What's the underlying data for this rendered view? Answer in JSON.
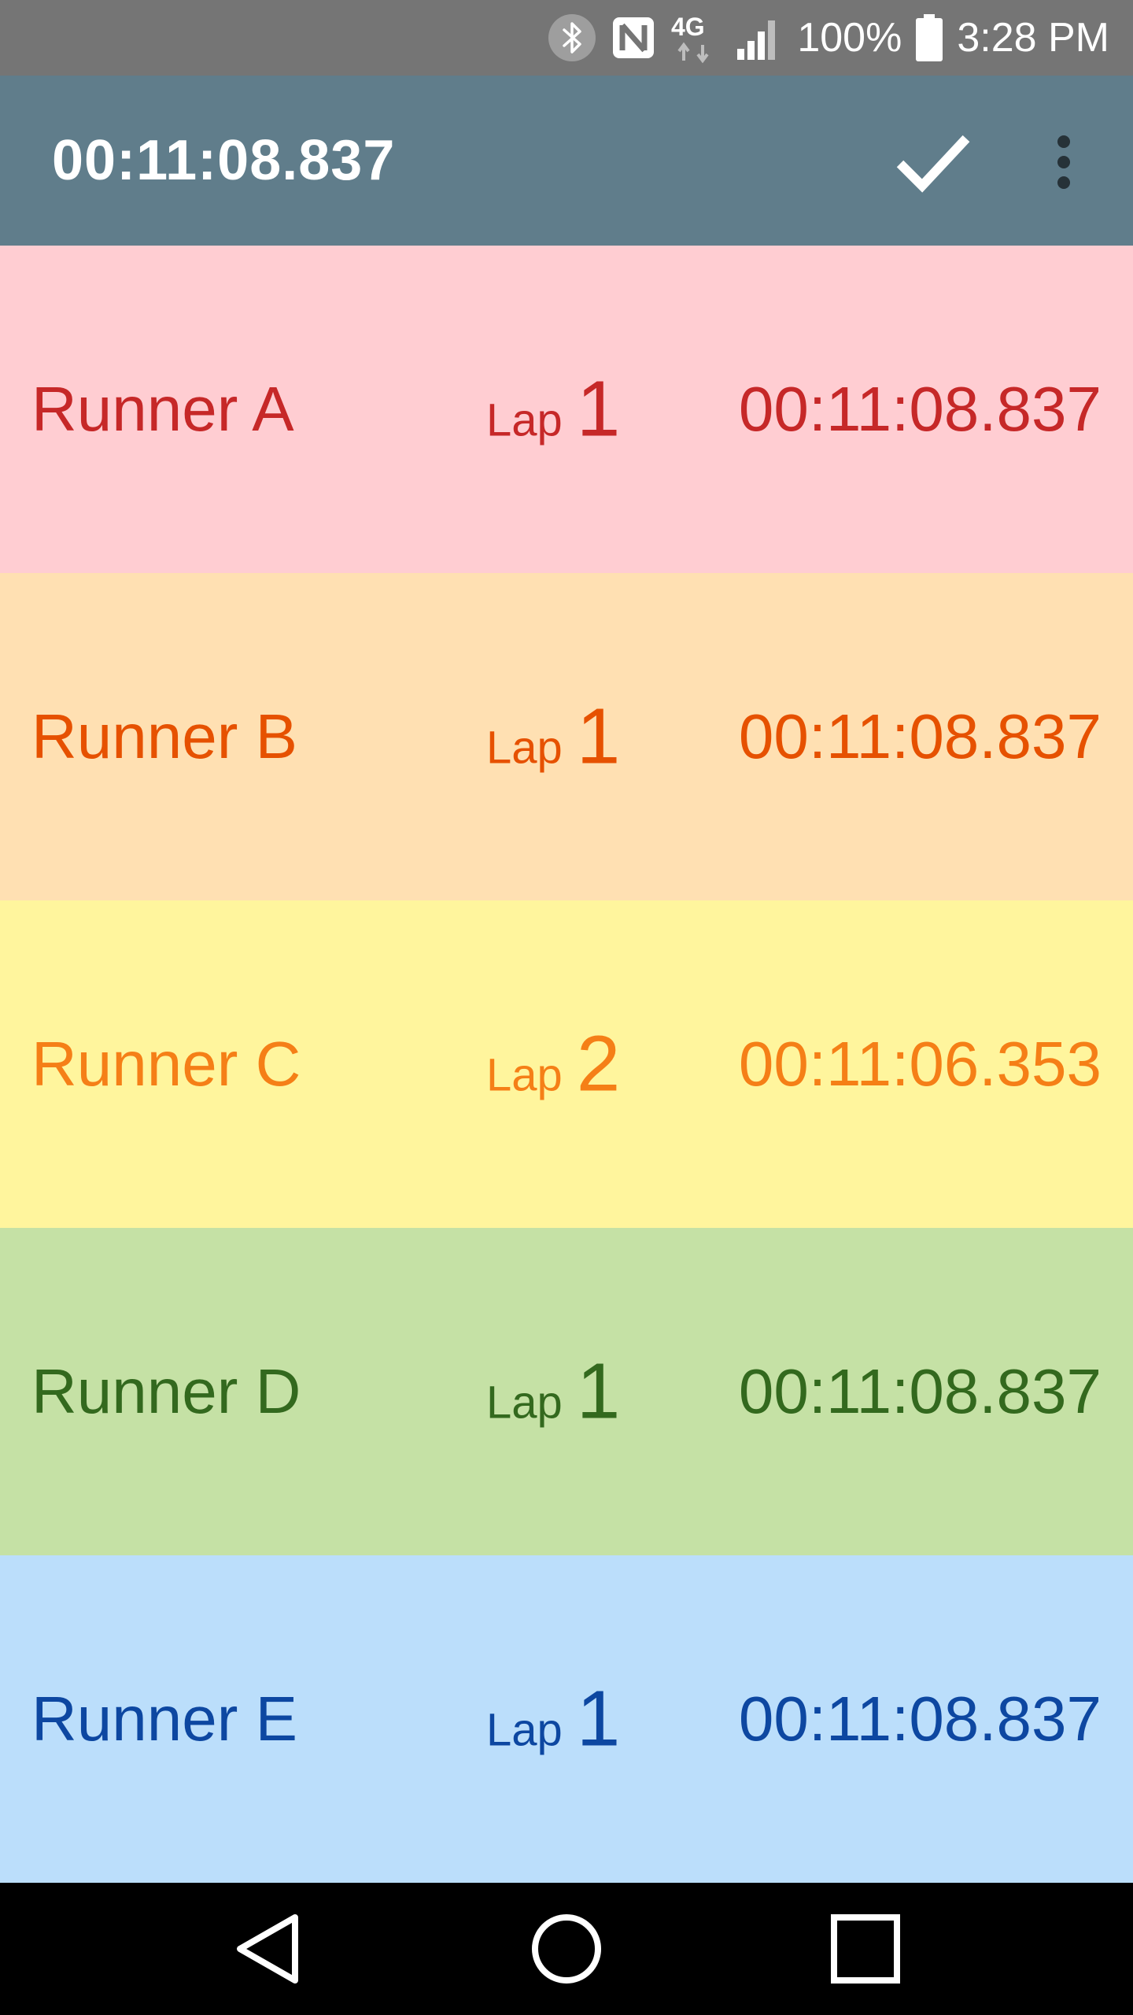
{
  "status_bar": {
    "icons": [
      "bluetooth-icon",
      "nfc-icon",
      "4g-lte-icon",
      "signal-icon",
      "battery-icon"
    ],
    "network_label": "4G",
    "battery": "100%",
    "time": "3:28 PM"
  },
  "app_bar": {
    "title": "00:11:08.837",
    "background": "#607d8b",
    "actions": [
      "check-icon",
      "more-vert-icon"
    ]
  },
  "runners": [
    {
      "name": "Runner A",
      "lap_label": "Lap",
      "lap": "1",
      "time": "00:11:08.837",
      "bg": "#ffcdd2",
      "fg": "#c62828"
    },
    {
      "name": "Runner B",
      "lap_label": "Lap",
      "lap": "1",
      "time": "00:11:08.837",
      "bg": "#ffe0b2",
      "fg": "#e65100"
    },
    {
      "name": "Runner C",
      "lap_label": "Lap",
      "lap": "2",
      "time": "00:11:06.353",
      "bg": "#fff59d",
      "fg": "#f57f17"
    },
    {
      "name": "Runner D",
      "lap_label": "Lap",
      "lap": "1",
      "time": "00:11:08.837",
      "bg": "#c5e1a5",
      "fg": "#33691e"
    },
    {
      "name": "Runner E",
      "lap_label": "Lap",
      "lap": "1",
      "time": "00:11:08.837",
      "bg": "#bbdefb",
      "fg": "#0d47a1"
    }
  ],
  "nav_bar": {
    "buttons": [
      "back-icon",
      "home-icon",
      "recents-icon"
    ]
  }
}
